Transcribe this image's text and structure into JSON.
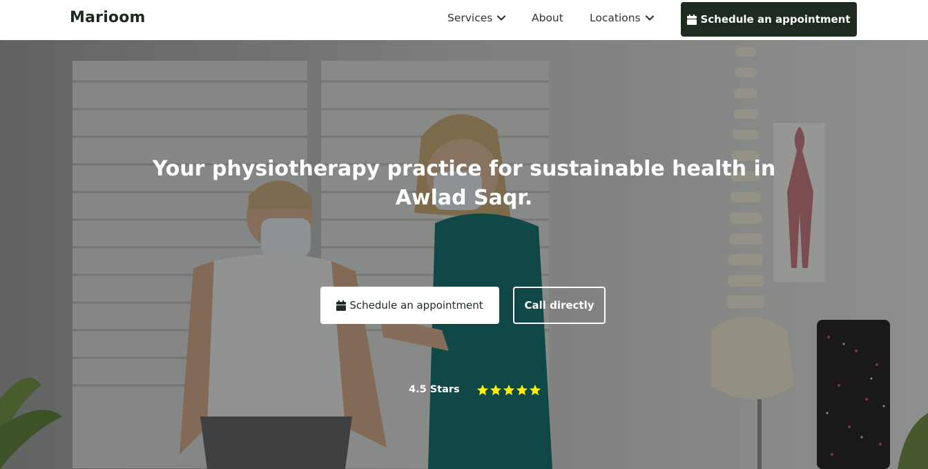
{
  "header": {
    "logo": "Marioom",
    "nav": [
      {
        "label": "Services",
        "icon": "chevron-down-icon"
      },
      {
        "label": "About"
      },
      {
        "label": "Locations",
        "icon": "chevron-down-icon"
      }
    ],
    "cta_label": "Schedule an appointment",
    "cta_icon": "calendar-icon"
  },
  "hero": {
    "title_line1": "Your physiotherapy practice for sustainable health in",
    "title_line2": "Awlad Saqr.",
    "primary_button": "Schedule an appointment",
    "secondary_button": "Call directly",
    "rating_text": "4.5 Stars",
    "rating_value": 4.5,
    "rating_max": 5
  },
  "colors": {
    "brand_dark": "#1f2a20",
    "star": "#fff200",
    "white": "#ffffff"
  }
}
